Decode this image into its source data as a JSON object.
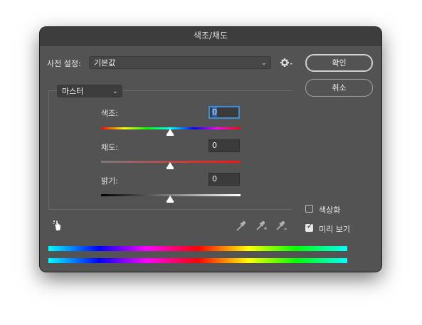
{
  "window": {
    "title": "색조/채도"
  },
  "preset": {
    "label": "사전 설정:",
    "value": "기본값"
  },
  "buttons": {
    "ok": "확인",
    "cancel": "취소"
  },
  "channel": {
    "value": "마스터"
  },
  "sliders": {
    "hue": {
      "label": "색조:",
      "value": "0",
      "position": 0.5
    },
    "saturation": {
      "label": "채도:",
      "value": "0",
      "position": 0.5
    },
    "lightness": {
      "label": "밝기:",
      "value": "0",
      "position": 0.5
    }
  },
  "options": {
    "colorize": {
      "label": "색상화",
      "checked": false
    },
    "preview": {
      "label": "미리 보기",
      "checked": true
    }
  },
  "icons": {
    "settings": "gear-icon",
    "targeted_adjust": "hand-icon",
    "eyedropper": "eyedropper-icon",
    "eyedropper_add": "eyedropper-plus-icon",
    "eyedropper_subtract": "eyedropper-minus-icon"
  }
}
